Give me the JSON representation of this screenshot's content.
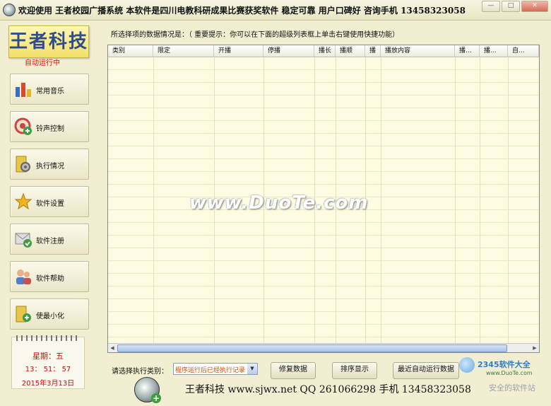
{
  "window": {
    "title": "欢迎使用 王者校园广播系统 本软件是四川电教科研成果比赛获奖软件 稳定可靠 用户口碑好 咨询手机 13458323058",
    "controls": [
      "—",
      "□",
      "✕"
    ]
  },
  "logo": "王者科技",
  "auto_status": "自动运行中",
  "nav": [
    {
      "label": "常用音乐",
      "icon": "bar-chart-icon"
    },
    {
      "label": "铃声控制",
      "icon": "bell-add-icon"
    },
    {
      "label": "执行情况",
      "icon": "folder-gear-icon"
    },
    {
      "label": "软件设置",
      "icon": "star-icon"
    },
    {
      "label": "软件注册",
      "icon": "envelope-check-icon"
    },
    {
      "label": "软件帮助",
      "icon": "users-icon"
    },
    {
      "label": "使最小化",
      "icon": "folder-add-icon"
    }
  ],
  "calendar": {
    "weekday": "星期：五",
    "time": "13： 51： 57",
    "date": "2015年3月13日"
  },
  "hint": "所选择项的数据情况是：（ 重要提示：你可以在下面的超级列表框上单击右键使用快捷功能）",
  "table": {
    "columns": [
      "类别",
      "限定",
      "开播",
      "停播",
      "播长",
      "播顺",
      "播",
      "播放内容",
      "播...",
      "播...",
      "自..."
    ],
    "rows": []
  },
  "watermark": "www.DuoTe.com",
  "bottom": {
    "exec_label": "请选择执行类别：",
    "select_value": "程序运行后已经执行记录",
    "restore_button": "修复数据",
    "sort_button": "排序显示",
    "recent_button": "最近自动运行数据"
  },
  "footer": "王者科技   www.sjwx.net QQ 261066298 手机 13458323058",
  "site_watermark": {
    "brand": "2345软件大全",
    "url": "www.DuoTe.com",
    "slogan": "安全的软件站"
  },
  "colors": {
    "bg": "#f1eed2",
    "accent": "#2f4d8a",
    "status": "#e01010"
  }
}
